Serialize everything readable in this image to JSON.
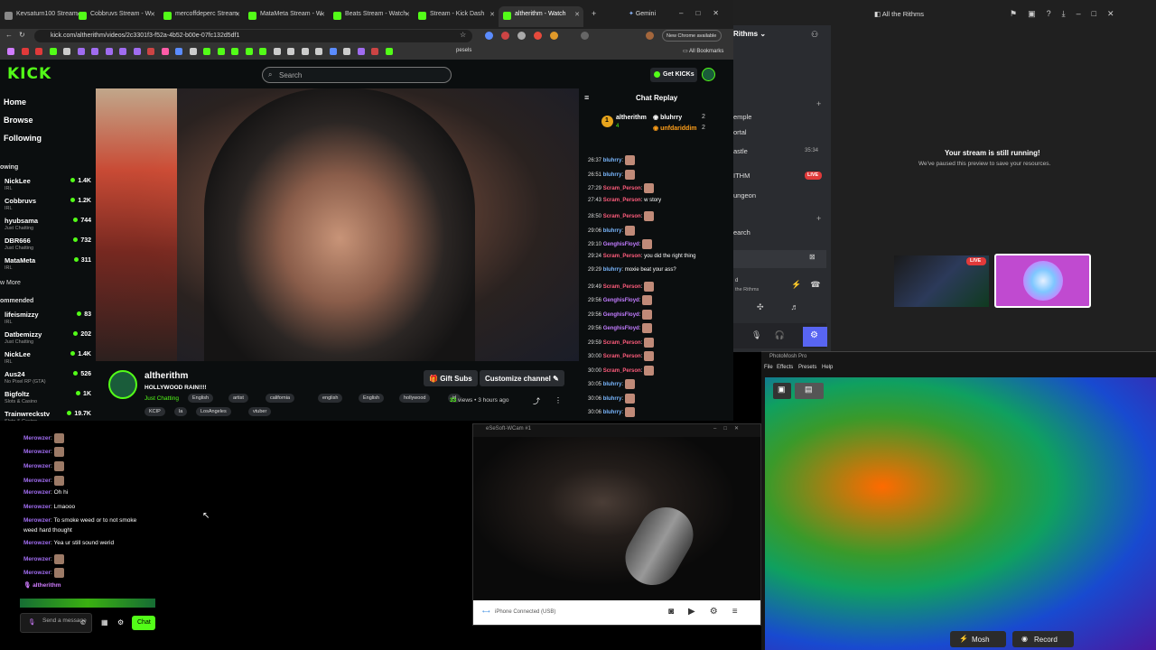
{
  "browser": {
    "tabs": [
      {
        "label": "Kevsaturn100 Stream",
        "active": false
      },
      {
        "label": "Cobbruvs Stream - W",
        "active": false
      },
      {
        "label": "mercoffdeperc Stream",
        "active": false
      },
      {
        "label": "MataMeta Stream - W",
        "active": false
      },
      {
        "label": "Beats Stream - Watch",
        "active": false
      },
      {
        "label": "Stream - Kick Dash",
        "active": false
      },
      {
        "label": "altherithm - Watch",
        "active": true
      }
    ],
    "gemini_label": "Gemini",
    "url": "kick.com/altherithm/videos/2c3301f3-f52a-4b52-b00e-07fc132d5df1",
    "chrome_badge": "New Chrome available",
    "bookmarks_site": "pesels",
    "all_bookmarks": "All Bookmarks"
  },
  "kick": {
    "logo": "KICK",
    "search_placeholder": "Search",
    "get_kicks": "Get KICKs",
    "nav": {
      "home": "Home",
      "browse": "Browse",
      "following": "Following"
    },
    "following_header": "owing",
    "following": [
      {
        "name": "NickLee",
        "cat": "IRL",
        "viewers": "1.4K"
      },
      {
        "name": "Cobbruvs",
        "cat": "IRL",
        "viewers": "1.2K"
      },
      {
        "name": "hyubsama",
        "cat": "Just Chatting",
        "viewers": "744"
      },
      {
        "name": "DBR666",
        "cat": "Just Chatting",
        "viewers": "732"
      },
      {
        "name": "MataMeta",
        "cat": "IRL",
        "viewers": "311"
      }
    ],
    "show_more": "w More",
    "recommended_header": "ommended",
    "recommended": [
      {
        "name": "lifeismizzy",
        "cat": "IRL",
        "viewers": "83"
      },
      {
        "name": "Datbemizzy",
        "cat": "Just Chatting",
        "viewers": "202"
      },
      {
        "name": "NickLee",
        "cat": "IRL",
        "viewers": "1.4K"
      },
      {
        "name": "Aus24",
        "cat": "No Pixel RP (GTA)",
        "viewers": "526"
      },
      {
        "name": "Bigfoltz",
        "cat": "Slots & Casino",
        "viewers": "1K"
      },
      {
        "name": "Trainwreckstv",
        "cat": "Slots & Casino",
        "viewers": "19.7K"
      }
    ],
    "streamer": "altherithm",
    "title": "HOLLYWOOD RAIN!!!!",
    "category": "Just Chatting",
    "tags_row1": [
      "English",
      "artist",
      "california",
      "english",
      "English",
      "hollywood",
      "irl"
    ],
    "tags_row2": [
      "KCIP",
      "la",
      "LosAngeles",
      "vtuber"
    ],
    "gift_subs": "Gift Subs",
    "customize": "Customize channel",
    "views": "33",
    "views_label": "views",
    "time_ago": "3 hours ago",
    "chat_header": "Chat Replay",
    "leaderboard": [
      {
        "rank": "1",
        "name": "altherithm",
        "sub": "4"
      },
      {
        "name": "bluhrry",
        "value": "2"
      },
      {
        "name": "unfdariddim",
        "value": "2"
      }
    ],
    "chat": [
      {
        "time": "26:37",
        "user": "bluhrry",
        "text": "",
        "color": "#7ab8ff"
      },
      {
        "time": "26:51",
        "user": "bluhrry",
        "text": "",
        "color": "#7ab8ff"
      },
      {
        "time": "27:29",
        "user": "Scram_Person",
        "text": "",
        "color": "#ff5c7c"
      },
      {
        "time": "27:43",
        "user": "Scram_Person",
        "text": "w story",
        "color": "#ff5c7c"
      },
      {
        "time": "28:50",
        "user": "Scram_Person",
        "text": "",
        "color": "#ff5c7c"
      },
      {
        "time": "29:06",
        "user": "bluhrry",
        "text": "",
        "color": "#7ab8ff"
      },
      {
        "time": "29:10",
        "user": "GenghisFloyd",
        "text": "",
        "color": "#c27cff"
      },
      {
        "time": "29:24",
        "user": "Scram_Person",
        "text": "you did the right thing",
        "color": "#ff5c7c"
      },
      {
        "time": "29:29",
        "user": "bluhrry",
        "text": "moxie beat your ass?",
        "color": "#7ab8ff"
      },
      {
        "time": "29:49",
        "user": "Scram_Person",
        "text": "",
        "color": "#ff5c7c"
      },
      {
        "time": "29:56",
        "user": "GenghisFloyd",
        "text": "",
        "color": "#c27cff"
      },
      {
        "time": "29:56",
        "user": "GenghisFloyd",
        "text": "",
        "color": "#c27cff"
      },
      {
        "time": "29:56",
        "user": "GenghisFloyd",
        "text": "",
        "color": "#c27cff"
      },
      {
        "time": "29:59",
        "user": "Scram_Person",
        "text": "",
        "color": "#ff5c7c"
      },
      {
        "time": "30:00",
        "user": "Scram_Person",
        "text": "",
        "color": "#ff5c7c"
      },
      {
        "time": "30:00",
        "user": "Scram_Person",
        "text": "",
        "color": "#ff5c7c"
      },
      {
        "time": "30:05",
        "user": "bluhrry",
        "text": "",
        "color": "#7ab8ff"
      },
      {
        "time": "30:06",
        "user": "bluhrry",
        "text": "",
        "color": "#7ab8ff"
      },
      {
        "time": "30:06",
        "user": "bluhrry",
        "text": "",
        "color": "#7ab8ff"
      }
    ]
  },
  "local_chat": {
    "messages": [
      {
        "user": "Merowzer",
        "text": ""
      },
      {
        "user": "Merowzer",
        "text": ""
      },
      {
        "user": "Merowzer",
        "text": ""
      },
      {
        "user": "Merowzer",
        "text": ""
      },
      {
        "user": "Merowzer",
        "text": "Oh hi"
      },
      {
        "user": "Merowzer",
        "text": "Lmaooo"
      },
      {
        "user": "Merowzer",
        "text": "To smoke weed or to not smoke"
      },
      {
        "user": "",
        "text": "weed hard thought"
      },
      {
        "user": "Merowzer",
        "text": "Yea ur still sound werid"
      },
      {
        "user": "Merowzer",
        "text": ""
      },
      {
        "user": "Merowzer",
        "text": ""
      }
    ],
    "self_user": "altherithm",
    "input_placeholder": "Send a message",
    "chat_button": "Chat"
  },
  "webcam": {
    "title": "eSeSoft-WCam #1",
    "status": "iPhone Connected (USB)"
  },
  "discord": {
    "title": "All the Rithms",
    "server": "Rithms",
    "channels": [
      "emple",
      "ortal",
      "astle",
      "ITHM",
      "ungeon",
      "earch"
    ],
    "time": "35:34",
    "live": "LIVE",
    "stream_msg": "Your stream is still running!",
    "stream_sub": "We've paused this preview to save your resources.",
    "user_line": "d",
    "user_sub": "the Rithms"
  },
  "photomosh": {
    "title": "PhotoMosh Pro",
    "menu": [
      "File",
      "Effects",
      "Presets",
      "Help"
    ],
    "mosh": "Mosh",
    "record": "Record"
  },
  "colors": {
    "kick_green": "#53fc18",
    "bg": "#0b0e0f",
    "chat_purple": "#a06cf0"
  }
}
